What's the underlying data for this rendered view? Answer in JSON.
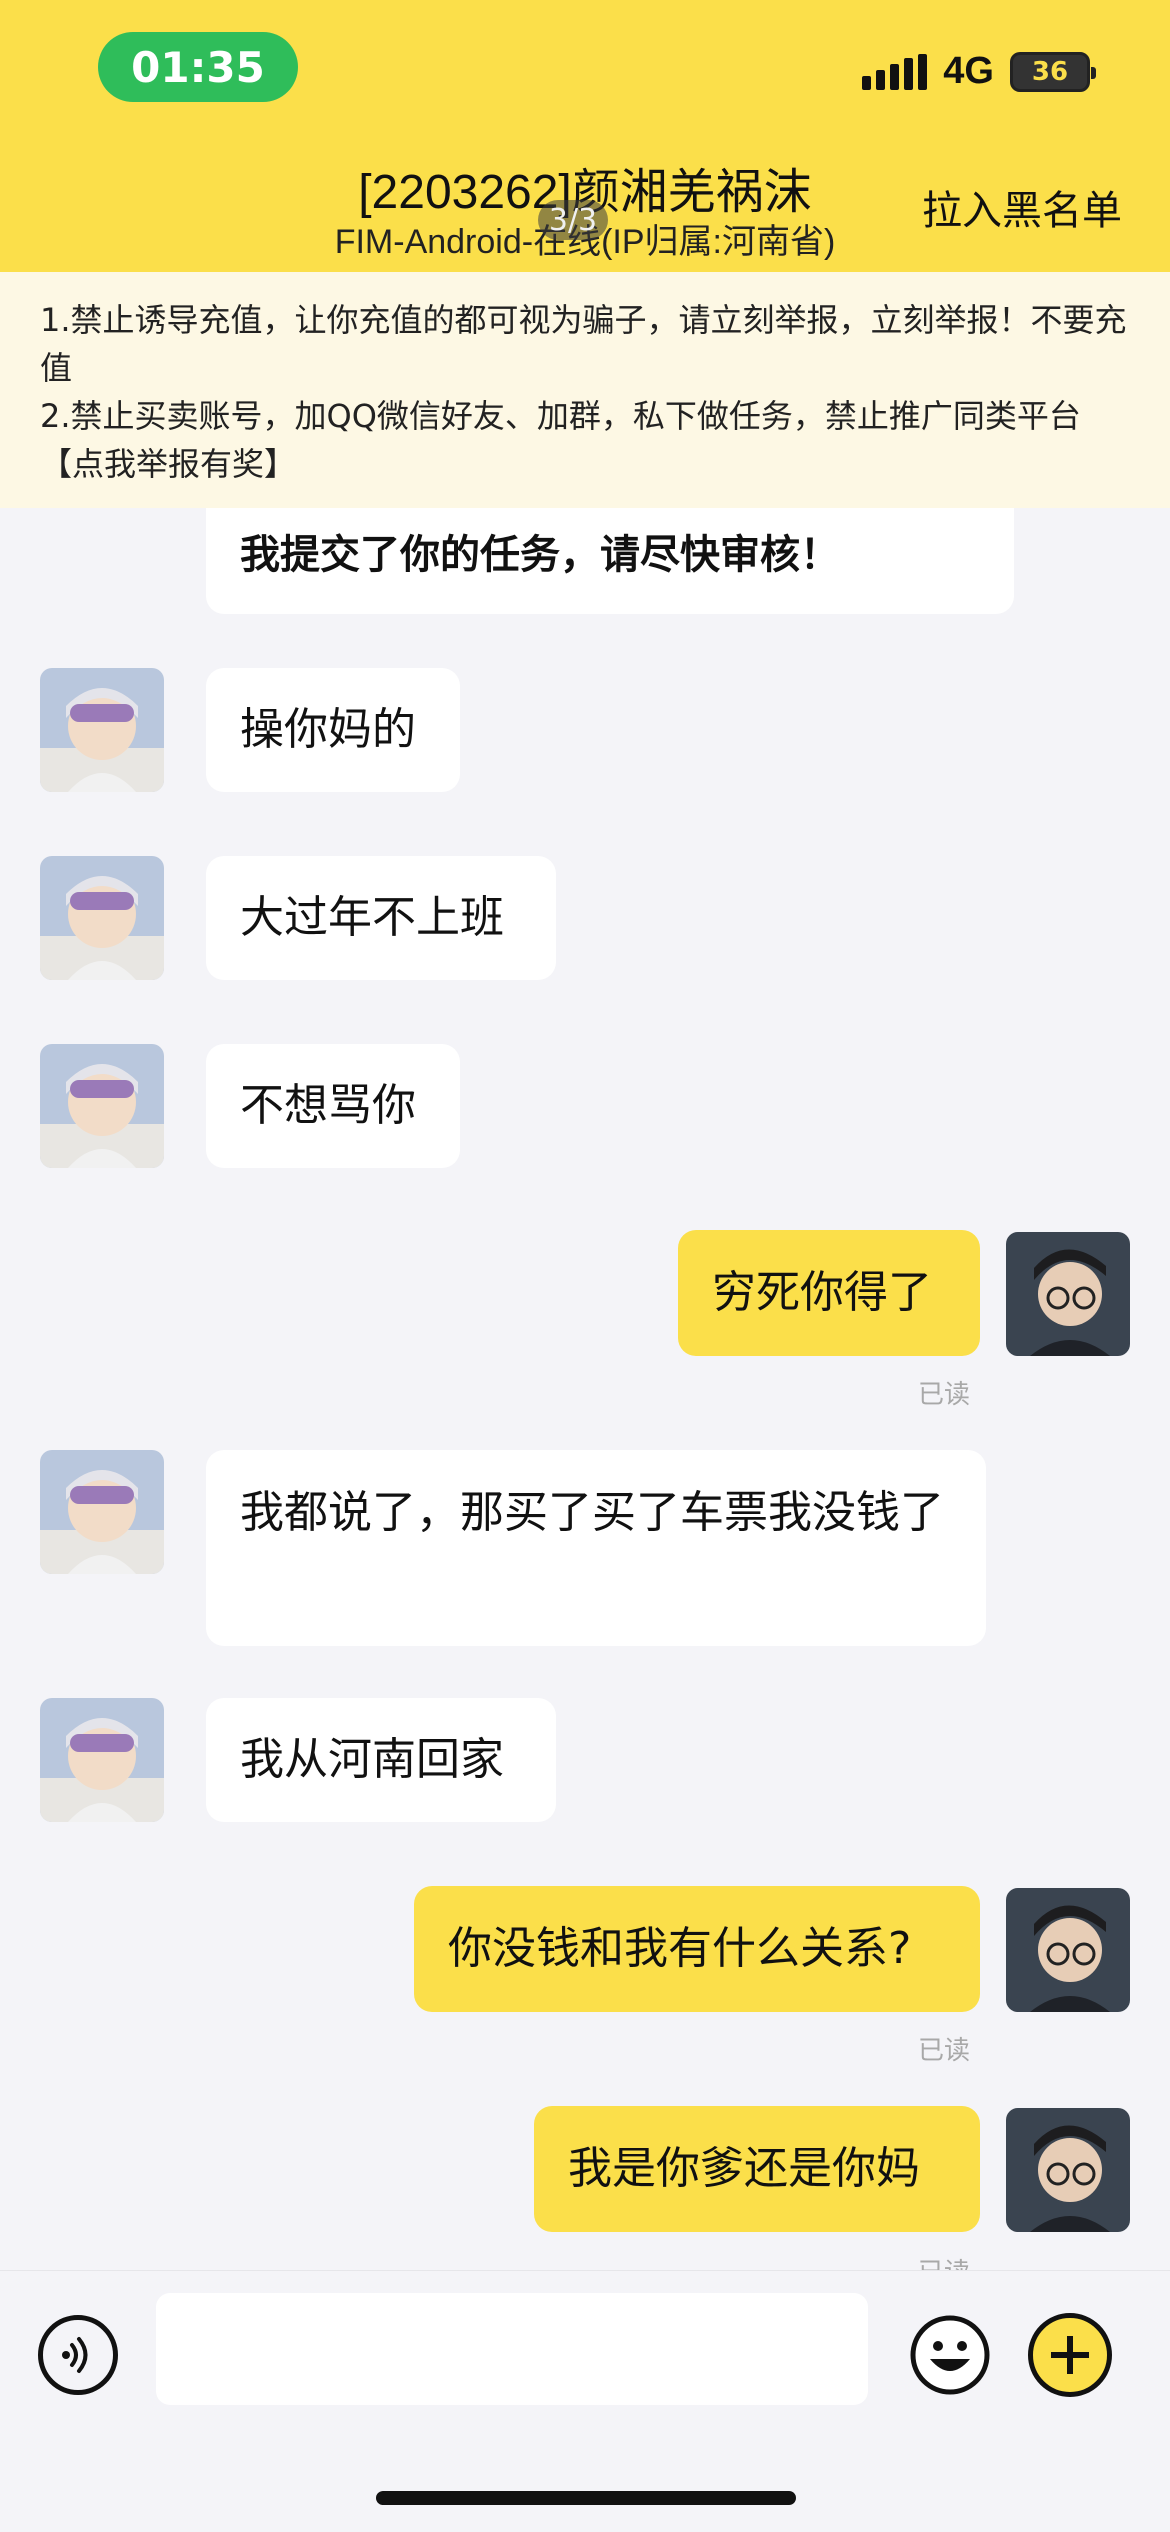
{
  "status_bar": {
    "time": "01:35",
    "network": "4G",
    "battery": "36"
  },
  "header": {
    "title": "[2203262]颜湘羌祸沫",
    "subtitle": "FIM-Android-在线(IP归属:河南省)",
    "pager": "3/3",
    "blacklist_label": "拉入黑名单",
    "accent_color": "#fbdf4a"
  },
  "notice": {
    "line1": "1.禁止诱导充值，让你充值的都可视为骗子，请立刻举报，立刻举报！不要充值",
    "line2": "2.禁止买卖账号，加QQ微信好友、加群，私下做任务，禁止推广同类平台【点我举报有奖】"
  },
  "messages": [
    {
      "side": "in",
      "text": "我提交了你的任务，请尽快审核！"
    },
    {
      "side": "in",
      "text": "操你妈的"
    },
    {
      "side": "in",
      "text": "大过年不上班"
    },
    {
      "side": "in",
      "text": "不想骂你"
    },
    {
      "side": "out",
      "text": "穷死你得了",
      "status": "已读"
    },
    {
      "side": "in",
      "text": "我都说了，那买了买了车票我没钱了"
    },
    {
      "side": "in",
      "text": "我从河南回家"
    },
    {
      "side": "out",
      "text": "你没钱和我有什么关系?",
      "status": "已读"
    },
    {
      "side": "out",
      "text": "我是你爹还是你妈",
      "status": "已读"
    }
  ],
  "composer": {
    "voice_icon": "voice-icon",
    "emoji_icon": "emoji-icon",
    "plus_icon": "plus-icon",
    "input_value": ""
  }
}
